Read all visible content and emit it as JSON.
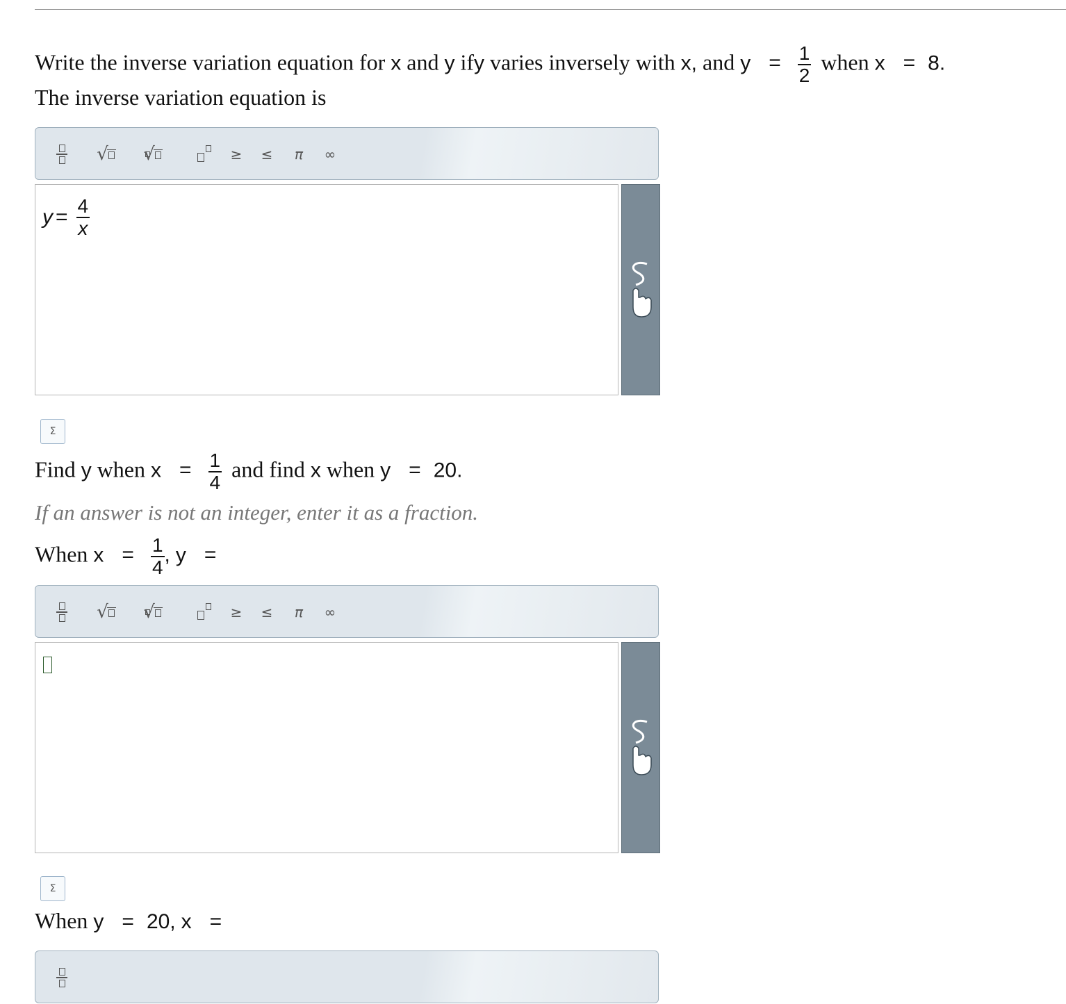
{
  "problem": {
    "q_write": "Write the inverse variation equation for",
    "var_x": "x",
    "word_and": "and",
    "var_y": "y",
    "word_if": "if",
    "q_varies": "varies inversely with",
    "x_comma": "x,",
    "word_and_y": "and",
    "equals": "=",
    "half_num": "1",
    "half_den": "2",
    "word_when": "when",
    "eight": "8.",
    "answer_prompt": "The inverse variation equation is"
  },
  "toolbar": {
    "fraction_icon": "fraction-template-icon",
    "sqrt_icon": "square-root-icon",
    "nthroot_icon": "nth-root-icon",
    "exponent_icon": "exponent-icon",
    "geq": "≥",
    "leq": "≤",
    "pi": "π",
    "infinity": "∞"
  },
  "answer1": {
    "lhs": "y",
    "equals": "=",
    "num": "4",
    "den": "x"
  },
  "part2": {
    "find": "Find",
    "y": "y",
    "when": "when",
    "x": "x",
    "equals": "=",
    "q_num": "1",
    "q_den": "4",
    "and_find": "and find",
    "when2": "when",
    "twenty": "20.",
    "hint": "If an answer is not an integer, enter it as a fraction.",
    "when_cap": "When",
    "comma": ",",
    "sigma": "Σ"
  },
  "part3": {
    "when_cap": "When",
    "y": "y",
    "equals": "=",
    "twenty": "20,",
    "x": "x"
  }
}
